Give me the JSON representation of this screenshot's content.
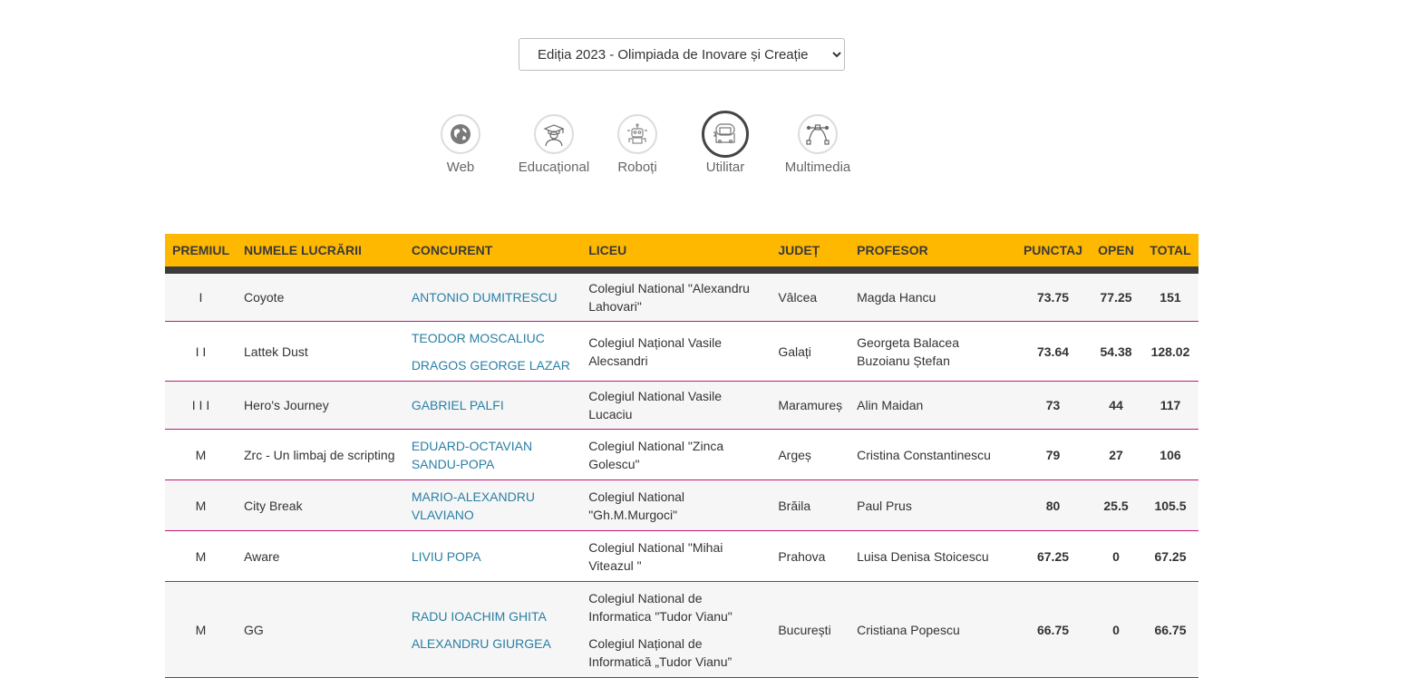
{
  "edition_select": {
    "selected": "Ediția 2023 - Olimpiada de Inovare și Creație"
  },
  "categories": [
    {
      "label": "Web",
      "icon": "globe-icon",
      "active": false
    },
    {
      "label": "Educațional",
      "icon": "graduate-icon",
      "active": false
    },
    {
      "label": "Roboți",
      "icon": "robot-icon",
      "active": false
    },
    {
      "label": "Utilitar",
      "icon": "utility-icon",
      "active": true
    },
    {
      "label": "Multimedia",
      "icon": "vector-pen-icon",
      "active": false
    }
  ],
  "table": {
    "headers": [
      "PREMIUL",
      "NUMELE LUCRĂRII",
      "CONCURENT",
      "LICEU",
      "JUDEȚ",
      "PROFESOR",
      "PUNCTAJ",
      "OPEN",
      "TOTAL"
    ],
    "rows": [
      {
        "premiu": "I",
        "lucrare": "Coyote",
        "concurenti": [
          "ANTONIO DUMITRESCU"
        ],
        "licee": [
          "Colegiul National \"Alexandru Lahovari\""
        ],
        "judet": "Vâlcea",
        "profesor": "Magda Hancu",
        "punctaj": "73.75",
        "open": "77.25",
        "total": "151"
      },
      {
        "premiu": "I I",
        "lucrare": "Lattek Dust",
        "concurenti": [
          "TEODOR MOSCALIUC",
          "DRAGOS GEORGE LAZAR"
        ],
        "licee": [
          "Colegiul Național Vasile Alecsandri"
        ],
        "judet": "Galați",
        "profesor": "Georgeta Balacea Buzoianu Ștefan",
        "punctaj": "73.64",
        "open": "54.38",
        "total": "128.02"
      },
      {
        "premiu": "I I I",
        "lucrare": "Hero's Journey",
        "concurenti": [
          "GABRIEL PALFI"
        ],
        "licee": [
          "Colegiul National Vasile Lucaciu"
        ],
        "judet": "Maramureș",
        "profesor": "Alin Maidan",
        "punctaj": "73",
        "open": "44",
        "total": "117"
      },
      {
        "premiu": "M",
        "lucrare": "Zrc - Un limbaj de scripting",
        "concurenti": [
          "EDUARD-OCTAVIAN SANDU-POPA"
        ],
        "licee": [
          "Colegiul National \"Zinca Golescu\""
        ],
        "judet": "Argeș",
        "profesor": "Cristina Constantinescu",
        "punctaj": "79",
        "open": "27",
        "total": "106"
      },
      {
        "premiu": "M",
        "lucrare": "City Break",
        "concurenti": [
          "MARIO-ALEXANDRU VLAVIANO"
        ],
        "licee": [
          "Colegiul National \"Gh.M.Murgoci\""
        ],
        "judet": "Brăila",
        "profesor": "Paul Prus",
        "punctaj": "80",
        "open": "25.5",
        "total": "105.5"
      },
      {
        "premiu": "M",
        "lucrare": "Aware",
        "concurenti": [
          "LIVIU POPA"
        ],
        "licee": [
          "Colegiul National \"Mihai Viteazul \""
        ],
        "judet": "Prahova",
        "profesor": "Luisa Denisa Stoicescu",
        "punctaj": "67.25",
        "open": "0",
        "total": "67.25"
      },
      {
        "premiu": "M",
        "lucrare": "GG",
        "concurenti": [
          "RADU IOACHIM GHITA",
          "ALEXANDRU GIURGEA"
        ],
        "licee": [
          "Colegiul National de Informatica \"Tudor Vianu\"",
          "Colegiul Național de Informatică „Tudor Vianu”"
        ],
        "judet": "București",
        "profesor": "Cristiana Popescu",
        "punctaj": "66.75",
        "open": "0",
        "total": "66.75"
      }
    ]
  }
}
